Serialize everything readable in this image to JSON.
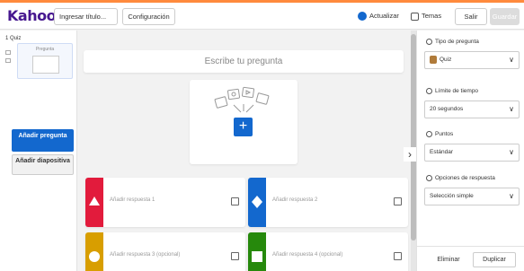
{
  "header": {
    "logo": "Kahoot!",
    "title_input_value": "Ingresar título...",
    "settings_label": "Configuración",
    "update_label": "Actualizar",
    "themes_label": "Temas",
    "exit_label": "Salir",
    "save_label": "Guardar"
  },
  "sidebar": {
    "slide_label": "1 Quiz",
    "thumb_label": "Pregunta",
    "add_question_label": "Añadir pregunta",
    "add_slide_label": "Añadir diapositiva"
  },
  "main": {
    "question_placeholder": "Escribe tu pregunta",
    "answers": [
      {
        "label": "Añadir respuesta 1",
        "color": "#e21b3c",
        "shape": "triangle-icon"
      },
      {
        "label": "Añadir respuesta 2",
        "color": "#1368ce",
        "shape": "diamond-icon"
      },
      {
        "label": "Añadir respuesta 3 (opcional)",
        "color": "#d89e00",
        "shape": "circle-icon"
      },
      {
        "label": "Añadir respuesta 4 (opcional)",
        "color": "#26890c",
        "shape": "square-icon"
      }
    ]
  },
  "panel": {
    "question_type_label": "Tipo de pregunta",
    "question_type_value": "Quiz",
    "time_limit_label": "Límite de tiempo",
    "time_limit_value": "20 segundos",
    "points_label": "Puntos",
    "points_value": "Estándar",
    "answer_options_label": "Opciones de respuesta",
    "answer_options_value": "Selección simple",
    "delete_label": "Eliminar",
    "duplicate_label": "Duplicar"
  }
}
